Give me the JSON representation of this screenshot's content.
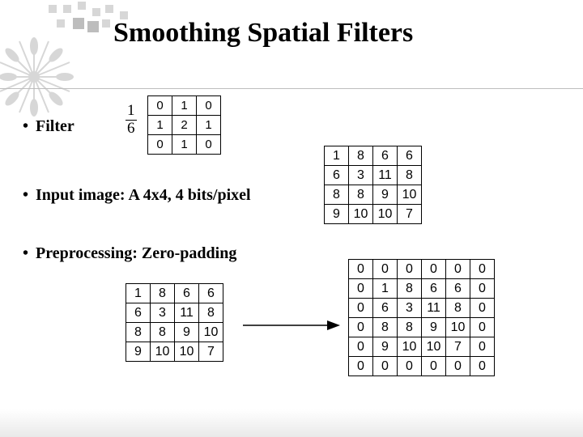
{
  "title": "Smoothing Spatial Filters",
  "bullets": {
    "b1": "Filter",
    "b2": "Input image: A 4x4, 4 bits/pixel",
    "b3": "Preprocessing: Zero-padding"
  },
  "fraction": {
    "num": "1",
    "den": "6"
  },
  "chart_data": [
    {
      "type": "table",
      "title": "filter kernel (3x3)",
      "values": [
        [
          0,
          1,
          0
        ],
        [
          1,
          2,
          1
        ],
        [
          0,
          1,
          0
        ]
      ]
    },
    {
      "type": "table",
      "title": "input image A (4x4)",
      "values": [
        [
          1,
          8,
          6,
          6
        ],
        [
          6,
          3,
          11,
          8
        ],
        [
          8,
          8,
          9,
          10
        ],
        [
          9,
          10,
          10,
          7
        ]
      ]
    },
    {
      "type": "table",
      "title": "zero-padded image (6x6)",
      "values": [
        [
          0,
          0,
          0,
          0,
          0,
          0
        ],
        [
          0,
          1,
          8,
          6,
          6,
          0
        ],
        [
          0,
          6,
          3,
          11,
          8,
          0
        ],
        [
          0,
          8,
          8,
          9,
          10,
          0
        ],
        [
          0,
          9,
          10,
          10,
          7,
          0
        ],
        [
          0,
          0,
          0,
          0,
          0,
          0
        ]
      ]
    }
  ]
}
